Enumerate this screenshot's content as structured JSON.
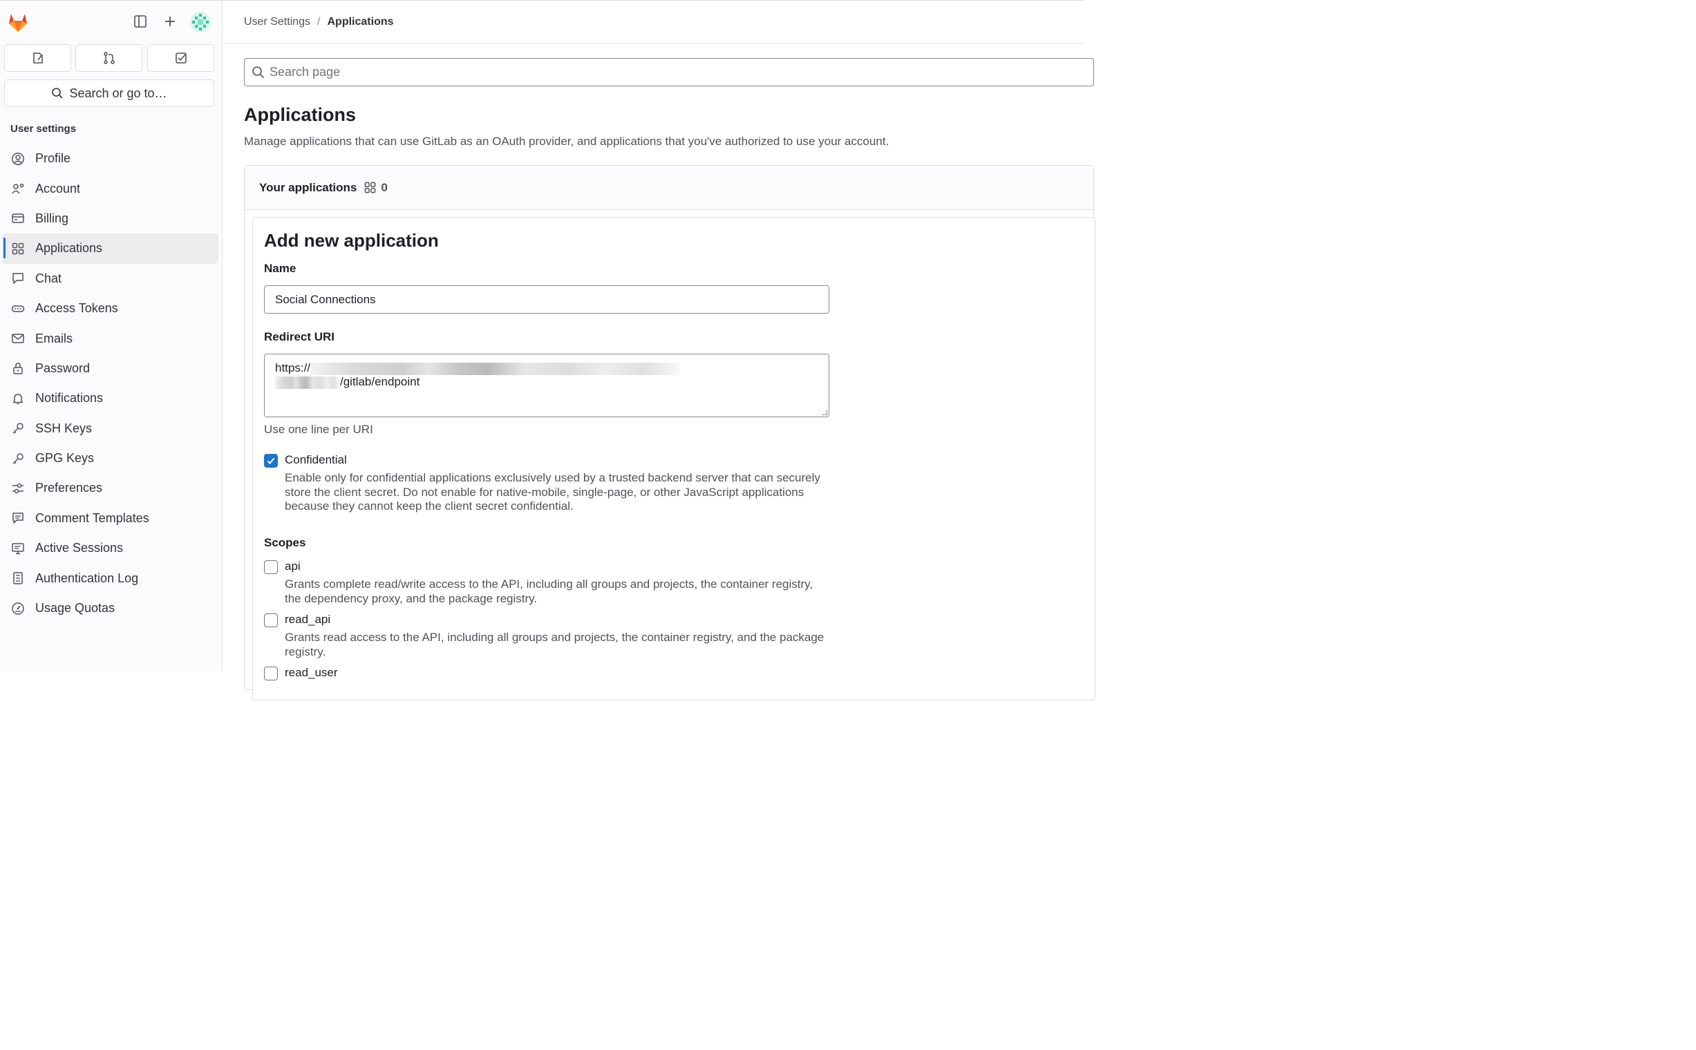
{
  "top": {
    "logo_icon": "gitlab-tanuki-icon",
    "brand_color": "#fc6d26",
    "sidebar_toggle_icon": "sidebar-toggle-icon",
    "new_icon": "plus-icon",
    "avatar_icon": "user-avatar"
  },
  "quick_actions": [
    {
      "icon": "issues-icon"
    },
    {
      "icon": "merge-request-icon"
    },
    {
      "icon": "todo-icon"
    }
  ],
  "search": {
    "label": "Search or go to…"
  },
  "nav": {
    "heading": "User settings",
    "items": [
      {
        "label": "Profile",
        "icon": "profile-icon"
      },
      {
        "label": "Account",
        "icon": "account-icon"
      },
      {
        "label": "Billing",
        "icon": "billing-icon"
      },
      {
        "label": "Applications",
        "icon": "applications-icon",
        "active": true
      },
      {
        "label": "Chat",
        "icon": "chat-icon"
      },
      {
        "label": "Access Tokens",
        "icon": "token-icon"
      },
      {
        "label": "Emails",
        "icon": "mail-icon"
      },
      {
        "label": "Password",
        "icon": "lock-icon"
      },
      {
        "label": "Notifications",
        "icon": "bell-icon"
      },
      {
        "label": "SSH Keys",
        "icon": "key-icon"
      },
      {
        "label": "GPG Keys",
        "icon": "key-icon"
      },
      {
        "label": "Preferences",
        "icon": "preferences-icon"
      },
      {
        "label": "Comment Templates",
        "icon": "comment-icon"
      },
      {
        "label": "Active Sessions",
        "icon": "monitor-icon"
      },
      {
        "label": "Authentication Log",
        "icon": "log-icon"
      },
      {
        "label": "Usage Quotas",
        "icon": "gauge-icon"
      }
    ]
  },
  "breadcrumb": {
    "parent": "User Settings",
    "separator": "/",
    "current": "Applications"
  },
  "page_search": {
    "placeholder": "Search page"
  },
  "page": {
    "title": "Applications",
    "description": "Manage applications that can use GitLab as an OAuth provider, and applications that you've authorized to use your account."
  },
  "your_apps": {
    "title": "Your applications",
    "count": "0"
  },
  "form": {
    "title": "Add new application",
    "name_label": "Name",
    "name_value": "Social Connections",
    "redirect_label": "Redirect URI",
    "redirect_prefix": "https://",
    "redirect_suffix": "/gitlab/endpoint",
    "redirect_help": "Use one line per URI",
    "confidential_label": "Confidential",
    "confidential_checked": true,
    "confidential_desc": "Enable only for confidential applications exclusively used by a trusted backend server that can securely store the client secret. Do not enable for native-mobile, single-page, or other JavaScript applications because they cannot keep the client secret confidential.",
    "scopes_label": "Scopes",
    "scopes": [
      {
        "name": "api",
        "desc": "Grants complete read/write access to the API, including all groups and projects, the container registry, the dependency proxy, and the package registry.",
        "checked": false
      },
      {
        "name": "read_api",
        "desc": "Grants read access to the API, including all groups and projects, the container registry, and the package registry.",
        "checked": false
      },
      {
        "name": "read_user",
        "desc": "",
        "checked": false
      }
    ]
  },
  "colors": {
    "accent": "#1f75cb",
    "sidebar_bg": "#fbfafd",
    "text": "#333238"
  }
}
